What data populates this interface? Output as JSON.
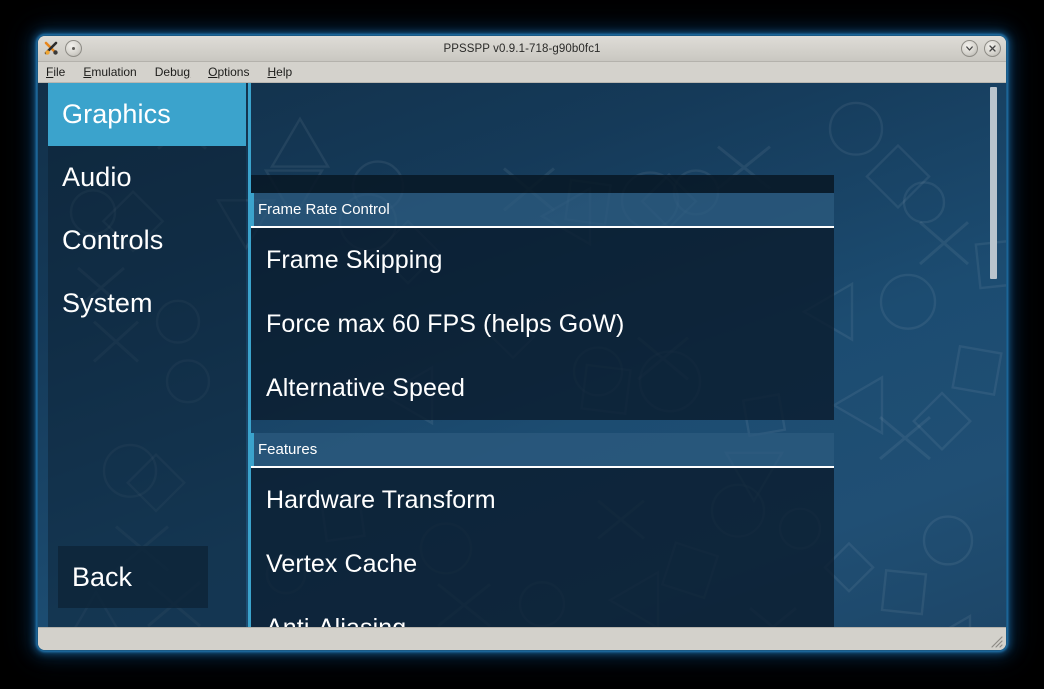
{
  "window": {
    "title": "PPSSPP v0.9.1-718-g90b0fc1",
    "app_icon": "ppsspp-app-icon",
    "window_menu_icon": "window-menu-icon",
    "minimize_icon": "chevron-down-icon",
    "close_icon": "close-icon"
  },
  "menubar": {
    "items": [
      {
        "label": "File",
        "mnemonic": "F"
      },
      {
        "label": "Emulation",
        "mnemonic": "E"
      },
      {
        "label": "Debug",
        "mnemonic": "g"
      },
      {
        "label": "Options",
        "mnemonic": "O"
      },
      {
        "label": "Help",
        "mnemonic": "H"
      }
    ]
  },
  "sidebar": {
    "items": [
      {
        "label": "Graphics",
        "selected": true
      },
      {
        "label": "Audio",
        "selected": false
      },
      {
        "label": "Controls",
        "selected": false
      },
      {
        "label": "System",
        "selected": false
      }
    ],
    "back_label": "Back"
  },
  "settings": {
    "sections": [
      {
        "title": "Frame Rate Control",
        "items": [
          "Frame Skipping",
          "Force max 60 FPS (helps GoW)",
          "Alternative Speed"
        ]
      },
      {
        "title": "Features",
        "items": [
          "Hardware Transform",
          "Vertex Cache",
          "Anti-Aliasing"
        ]
      }
    ]
  },
  "colors": {
    "accent_teal": "#3ba3cc",
    "panel_dark": "#0a1c2d",
    "background_blue": "#1c4c71",
    "section_header": "#2c5a7e",
    "text_white": "#ffffff",
    "chrome_gray": "#d3d1cb",
    "scrollbar_thumb": "#b9c4cd"
  },
  "scrollbar": {
    "name": "vertical-scrollbar",
    "thumb_position_percent": 1,
    "thumb_size_percent": 35
  },
  "statusbar": {
    "text": "",
    "resize_grip_icon": "resize-grip-icon"
  }
}
